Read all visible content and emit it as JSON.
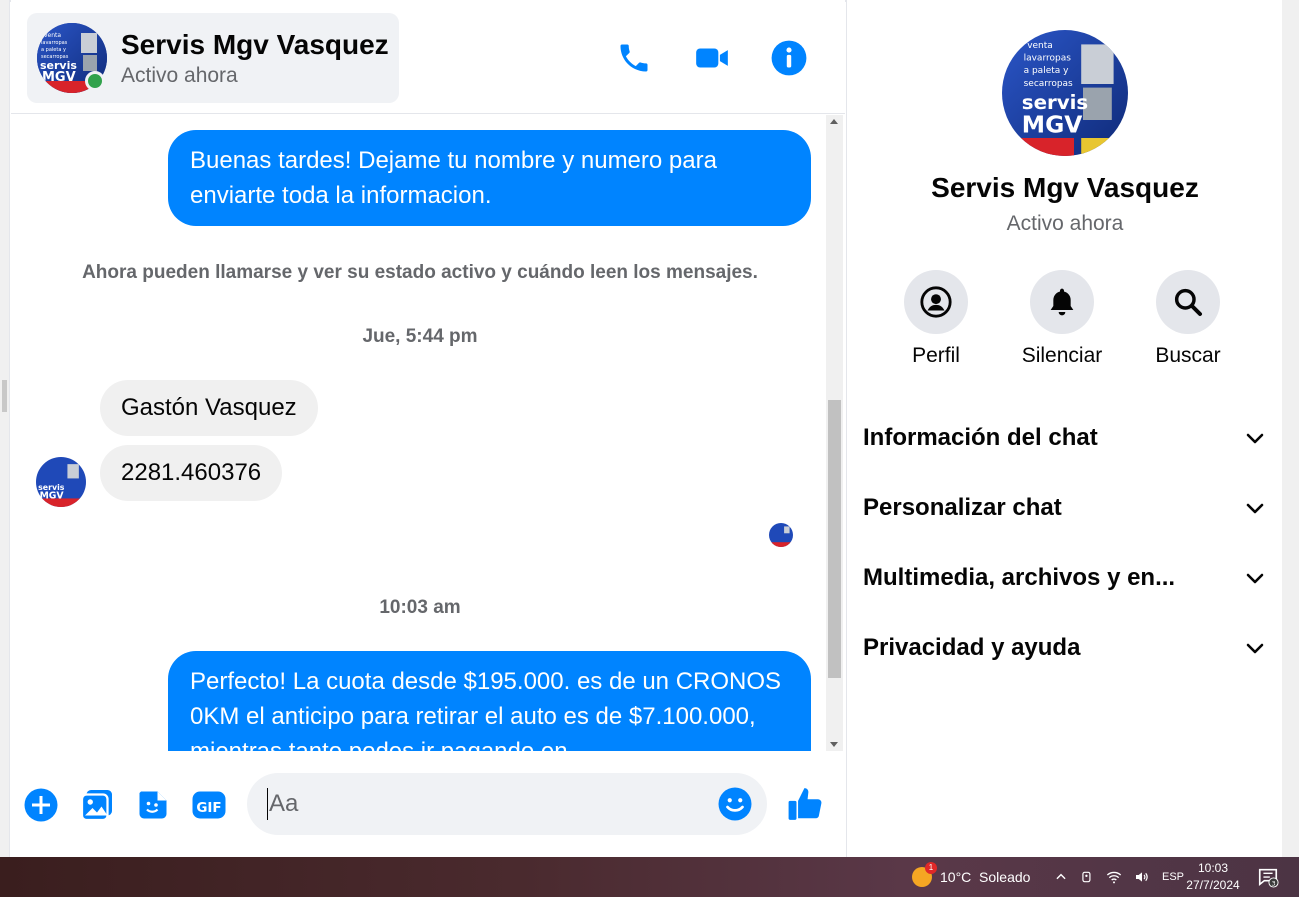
{
  "header": {
    "contact_name": "Servis Mgv Vasquez",
    "contact_status": "Activo ahora",
    "icons": [
      "phone-icon",
      "video-icon",
      "info-icon"
    ]
  },
  "avatar": {
    "lines": [
      "venta",
      "lavarropas",
      "a paleta y",
      "secarropas",
      "servis",
      "MGV"
    ]
  },
  "messages": {
    "outgoing_1": "Buenas tardes! Dejame tu nombre y numero para enviarte toda la informacion.",
    "system_note": "Ahora pueden llamarse y ver su estado activo y cuándo leen los mensajes.",
    "timestamp_1": "Jue, 5:44 pm",
    "incoming_1": "Gastón Vasquez",
    "incoming_2": "2281.460376",
    "timestamp_2": "10:03 am",
    "outgoing_2": "Perfecto! La cuota desde $195.000. es de un CRONOS 0KM el anticipo para retirar el auto es de $7.100.000, mientras tanto podes ir pagando en"
  },
  "composer": {
    "placeholder": "Aa",
    "icons": [
      "plus-icon",
      "gallery-icon",
      "sticker-icon",
      "gif-icon",
      "emoji-icon",
      "like-icon"
    ],
    "gif_label": "GIF"
  },
  "info_panel": {
    "name": "Servis Mgv Vasquez",
    "status": "Activo ahora",
    "actions": [
      {
        "label": "Perfil",
        "icon": "profile-icon"
      },
      {
        "label": "Silenciar",
        "icon": "bell-icon"
      },
      {
        "label": "Buscar",
        "icon": "search-icon"
      }
    ],
    "sections": [
      "Información del chat",
      "Personalizar chat",
      "Multimedia, archivos y en...",
      "Privacidad y ayuda"
    ]
  },
  "taskbar": {
    "weather_badge": "1",
    "weather": "10°C  Soleado",
    "language": "ESP",
    "time": "10:03",
    "date": "27/7/2024",
    "notifications": "3"
  },
  "colors": {
    "messenger_blue": "#0084ff",
    "online_green": "#31a24c",
    "bubble_gray": "#f0f0f0"
  }
}
